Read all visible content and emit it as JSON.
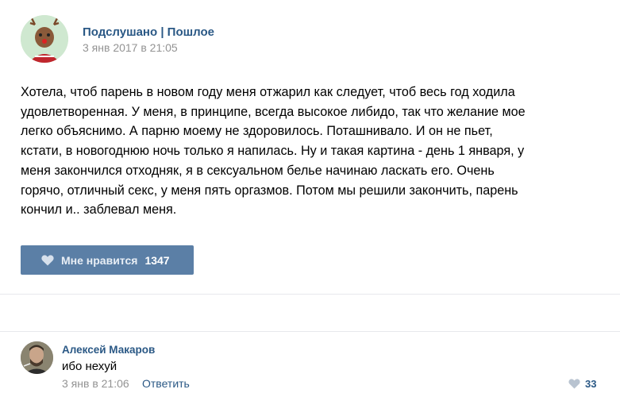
{
  "post": {
    "group_name": "Подслушано | Пошлое",
    "date": "3 янв 2017 в 21:05",
    "text_lines": [
      "Хотела, чтоб парень в новом году меня отжарил как следует, чтоб весь год ходила",
      "удовлетворенная. У меня, в принципе, всегда высокое либидо, так что желание мое",
      "легко объяснимо. А парню моему не здоровилось. Поташнивало. И он не пьет,",
      "кстати, в новогоднюю ночь только я напилась. Ну и такая картина - день 1 января, у",
      "меня закончился отходняк, я в сексуальном белье начинаю ласкать его. Очень",
      "горячо, отличный секс, у меня пять оргазмов. Потом мы решили закончить, парень",
      "кончил и.. заблевал меня."
    ],
    "like_label": "Мне нравится",
    "like_count": "1347"
  },
  "comment": {
    "author": "Алексей Макаров",
    "text": "ибо нехуй",
    "date": "3 янв в 21:06",
    "reply_label": "Ответить",
    "like_count": "33"
  },
  "icons": {
    "group_avatar": "reindeer-avatar-icon",
    "user_avatar": "user-photo-avatar",
    "like": "heart-icon"
  },
  "colors": {
    "link": "#2a5885",
    "like_button": "#5b7fa6",
    "meta": "#939393"
  }
}
